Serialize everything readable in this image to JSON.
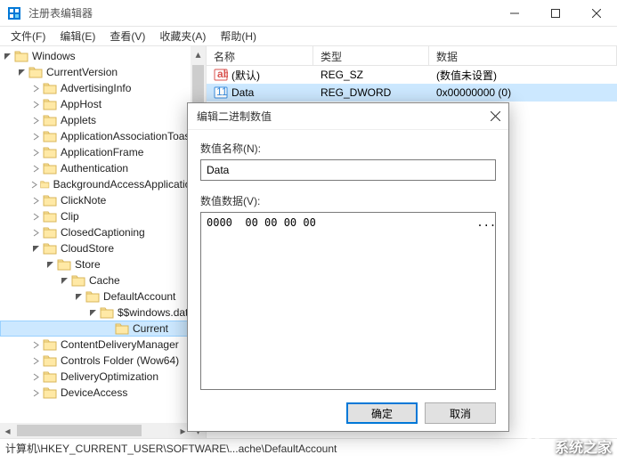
{
  "window": {
    "title": "注册表编辑器"
  },
  "menu": {
    "file": "文件(F)",
    "edit": "编辑(E)",
    "view": "查看(V)",
    "fav": "收藏夹(A)",
    "help": "帮助(H)"
  },
  "tree": {
    "root": "Windows",
    "cv": "CurrentVersion",
    "items": [
      "AdvertisingInfo",
      "AppHost",
      "Applets",
      "ApplicationAssociationToasts",
      "ApplicationFrame",
      "Authentication",
      "BackgroundAccessApplications",
      "ClickNote",
      "Clip",
      "ClosedCaptioning"
    ],
    "cloud": "CloudStore",
    "store": "Store",
    "cache": "Cache",
    "defacc": "DefaultAccount",
    "windat": "$$windows.data",
    "current": "Current",
    "tail": [
      "ContentDeliveryManager",
      "Controls Folder (Wow64)",
      "DeliveryOptimization",
      "DeviceAccess"
    ]
  },
  "list": {
    "cols": {
      "name": "名称",
      "type": "类型",
      "data": "数据"
    },
    "rows": [
      {
        "name": "(默认)",
        "type": "REG_SZ",
        "data": "(数值未设置)",
        "icon": "str"
      },
      {
        "name": "Data",
        "type": "REG_DWORD",
        "data": "0x00000000 (0)",
        "icon": "bin"
      }
    ]
  },
  "dialog": {
    "title": "编辑二进制数值",
    "name_label": "数值名称(N):",
    "name_value": "Data",
    "data_label": "数值数据(V):",
    "hex": "0000  00 00 00 00                         ....",
    "ok": "确定",
    "cancel": "取消"
  },
  "status": "计算机\\HKEY_CURRENT_USER\\SOFTWARE\\...ache\\DefaultAccount",
  "watermark": "系统之家"
}
